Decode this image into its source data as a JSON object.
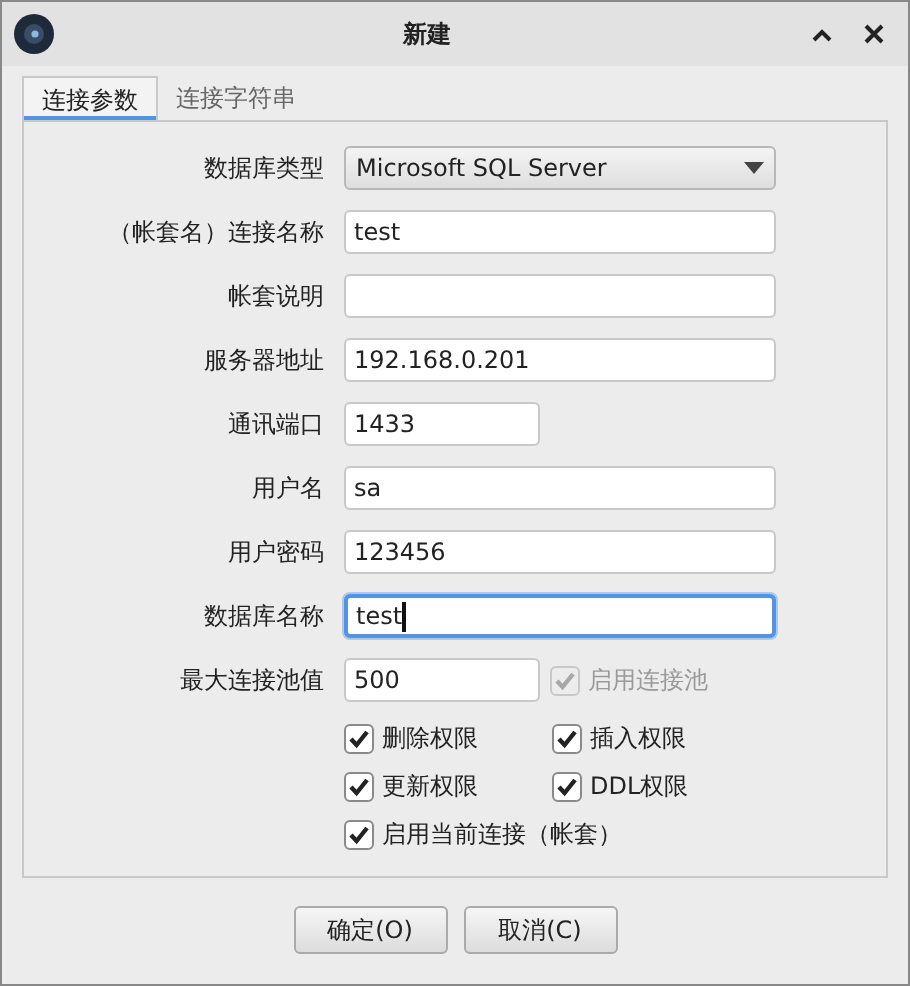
{
  "window": {
    "title": "新建"
  },
  "tabs": [
    {
      "label": "连接参数",
      "selected": true
    },
    {
      "label": "连接字符串",
      "selected": false
    }
  ],
  "fields": [
    {
      "label": "数据库类型",
      "kind": "select",
      "value": "Microsoft SQL Server"
    },
    {
      "label": "（帐套名）连接名称",
      "kind": "text",
      "value": "test"
    },
    {
      "label": "帐套说明",
      "kind": "text"
    },
    {
      "label": "服务器地址",
      "kind": "text",
      "value": "192.168.0.201"
    },
    {
      "label": "通讯端口",
      "kind": "short",
      "value": "1433"
    },
    {
      "label": "用户名",
      "kind": "text",
      "value": "sa"
    },
    {
      "label": "用户密码",
      "kind": "text",
      "value": "123456"
    },
    {
      "label": "数据库名称",
      "kind": "text",
      "value": "test",
      "focused": true
    },
    {
      "label": "最大连接池值",
      "kind": "short",
      "value": "500",
      "checkbox": {
        "label": "启用连接池",
        "checked": true,
        "disabled": true
      }
    }
  ],
  "options": [
    {
      "label": "删除权限",
      "checked": true,
      "disabled": false
    },
    {
      "label": "插入权限",
      "checked": true,
      "disabled": false
    },
    {
      "label": "更新权限",
      "checked": true,
      "disabled": false
    },
    {
      "label": "DDL权限",
      "checked": true,
      "disabled": false
    },
    {
      "label": "启用当前连接（帐套）",
      "checked": true,
      "disabled": false
    }
  ],
  "buttons": [
    "确定(O)",
    "取消(C)"
  ]
}
